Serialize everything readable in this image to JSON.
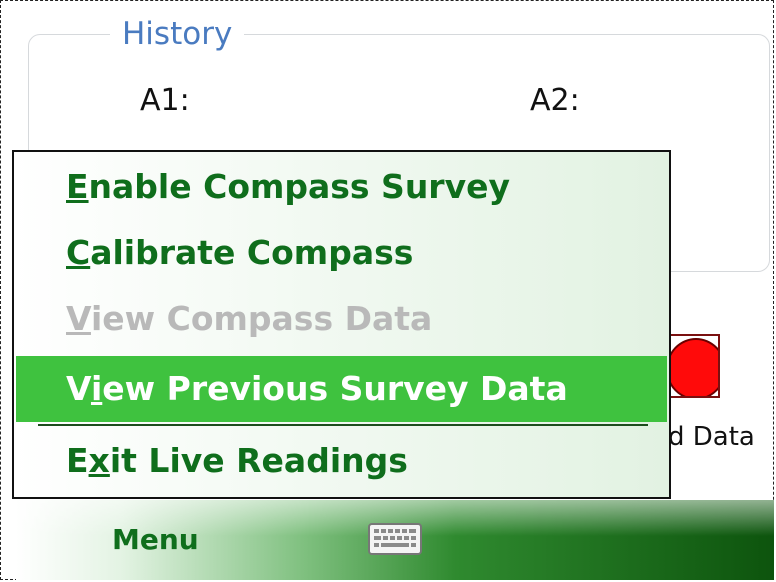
{
  "history": {
    "title": "History",
    "fields": [
      {
        "label": "A1:"
      },
      {
        "label": "A2:"
      }
    ]
  },
  "status": {
    "label": "d Data",
    "indicator_color": "#ff0a0a"
  },
  "menu": {
    "items": [
      {
        "pre": "",
        "key": "E",
        "post": "nable Compass Survey",
        "state": "normal"
      },
      {
        "pre": "",
        "key": "C",
        "post": "alibrate Compass",
        "state": "normal"
      },
      {
        "pre": "",
        "key": "V",
        "post": "iew Compass Data",
        "state": "disabled"
      },
      {
        "pre": "V",
        "key": "i",
        "post": "ew Previous Survey Data",
        "state": "selected"
      },
      {
        "pre": "E",
        "key": "x",
        "post": "it Live Readings",
        "state": "normal"
      }
    ]
  },
  "softkeys": {
    "left_label": "Menu",
    "right_icon": "keyboard-icon"
  },
  "colors": {
    "menu_text": "#0f6e1c",
    "selected_bg": "#3fc23f",
    "disabled_text": "#b9b9b9",
    "group_title": "#4a7bc0"
  }
}
